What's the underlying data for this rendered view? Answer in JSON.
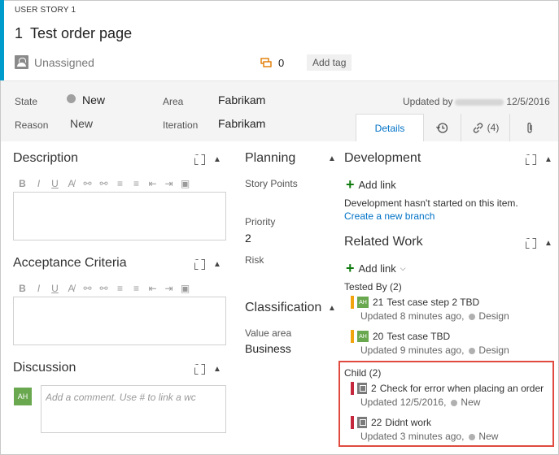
{
  "header": {
    "type_label": "USER STORY 1",
    "id": "1",
    "title": "Test order page",
    "assignee": "Unassigned",
    "comment_count": "0",
    "add_tag": "Add tag"
  },
  "fields": {
    "state_label": "State",
    "state_value": "New",
    "reason_label": "Reason",
    "reason_value": "New",
    "area_label": "Area",
    "area_value": "Fabrikam",
    "iteration_label": "Iteration",
    "iteration_value": "Fabrikam",
    "updated_by_prefix": "Updated by",
    "updated_date": "12/5/2016"
  },
  "tabs": {
    "details": "Details",
    "links_count": "(4)"
  },
  "description": {
    "title": "Description"
  },
  "acceptance": {
    "title": "Acceptance Criteria"
  },
  "discussion": {
    "title": "Discussion",
    "avatar_initials": "AH",
    "placeholder": "Add a comment. Use # to link a wc"
  },
  "planning": {
    "title": "Planning",
    "story_points_label": "Story Points",
    "priority_label": "Priority",
    "priority_value": "2",
    "risk_label": "Risk"
  },
  "classification": {
    "title": "Classification",
    "value_area_label": "Value area",
    "value_area_value": "Business"
  },
  "development": {
    "title": "Development",
    "add_link": "Add link",
    "message": "Development hasn't started on this item.",
    "create_branch": "Create a new branch"
  },
  "related_work": {
    "title": "Related Work",
    "add_link": "Add link",
    "tested_by_label": "Tested By (2)",
    "child_label": "Child (2)",
    "tested_by": [
      {
        "avatar": "AH",
        "id": "21",
        "title": "Test case step 2 TBD",
        "updated": "Updated 8 minutes ago,",
        "state": "Design"
      },
      {
        "avatar": "AH",
        "id": "20",
        "title": "Test case TBD",
        "updated": "Updated 9 minutes ago,",
        "state": "Design"
      }
    ],
    "children": [
      {
        "id": "2",
        "title": "Check for error when placing an order",
        "updated": "Updated 12/5/2016,",
        "state": "New"
      },
      {
        "id": "22",
        "title": "Didnt work",
        "updated": "Updated 3 minutes ago,",
        "state": "New"
      }
    ]
  },
  "colors": {
    "accent": "#009ccc",
    "highlight": "#e04a3f",
    "test_case_bar": "#f2a40e",
    "user_story_bar": "#c5283d",
    "link": "#0072c6",
    "add_green": "#107c10"
  }
}
